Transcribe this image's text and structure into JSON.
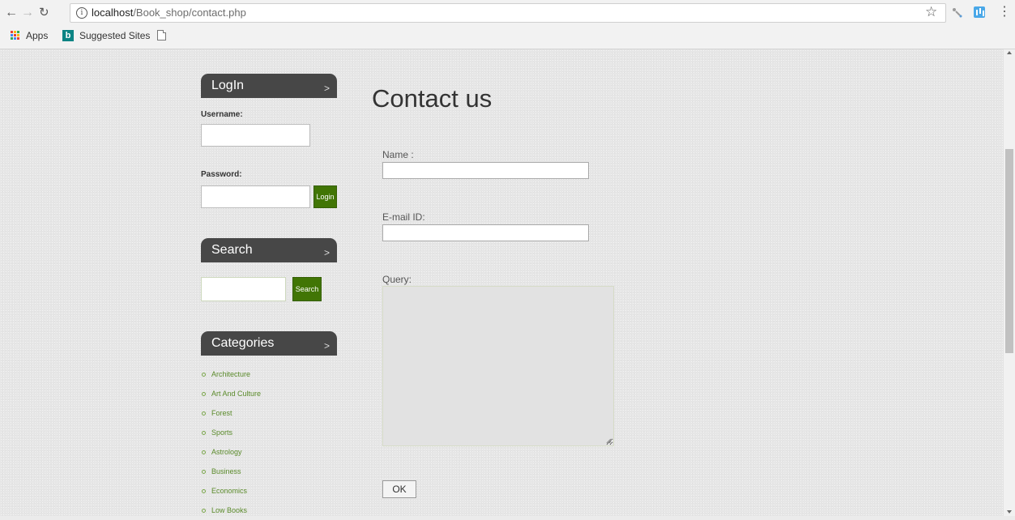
{
  "browser": {
    "url_host": "localhost",
    "url_path": "/Book_shop/contact.php",
    "bookmarks": [
      {
        "label": "Apps",
        "icon": "apps-grid-icon"
      },
      {
        "label": "Suggested Sites",
        "icon": "bing-icon"
      },
      {
        "label": "",
        "icon": "page-icon"
      }
    ]
  },
  "sidebar": {
    "login": {
      "title": "LogIn",
      "username_label": "Username:",
      "username_value": "",
      "password_label": "Password:",
      "password_value": "",
      "button": "Login"
    },
    "search": {
      "title": "Search",
      "value": "",
      "button": "Search"
    },
    "categories": {
      "title": "Categories",
      "items": [
        "Architecture",
        "Art And Culture",
        "Forest",
        "Sports",
        "Astrology",
        "Business",
        "Economics",
        "Low Books"
      ]
    }
  },
  "contact": {
    "title": "Contact us",
    "name_label": "Name :",
    "name_value": "",
    "email_label": "E-mail ID:",
    "email_value": "",
    "query_label": "Query:",
    "query_value": "",
    "submit": "OK"
  },
  "colors": {
    "panel_header": "#474747",
    "green_button": "#417505",
    "category_link": "#5a8a2a"
  }
}
